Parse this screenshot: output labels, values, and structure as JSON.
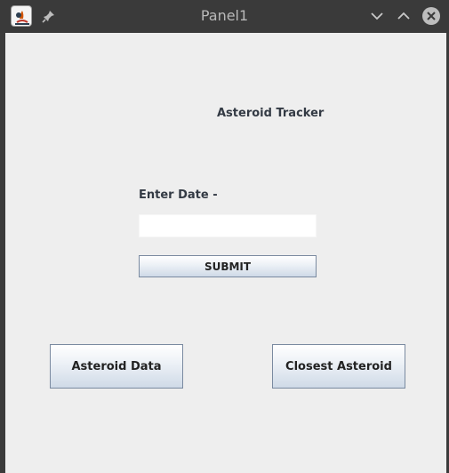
{
  "window": {
    "title": "Panel1",
    "icons": [
      "java-app-icon",
      "pin-icon",
      "minimize-icon",
      "maximize-icon",
      "close-icon"
    ]
  },
  "main": {
    "heading": "Asteroid Tracker",
    "date_label": "Enter Date -",
    "date_input": {
      "value": "",
      "placeholder": ""
    },
    "submit_label": "SUBMIT",
    "asteroid_data_label": "Asteroid Data",
    "closest_asteroid_label": "Closest Asteroid"
  }
}
